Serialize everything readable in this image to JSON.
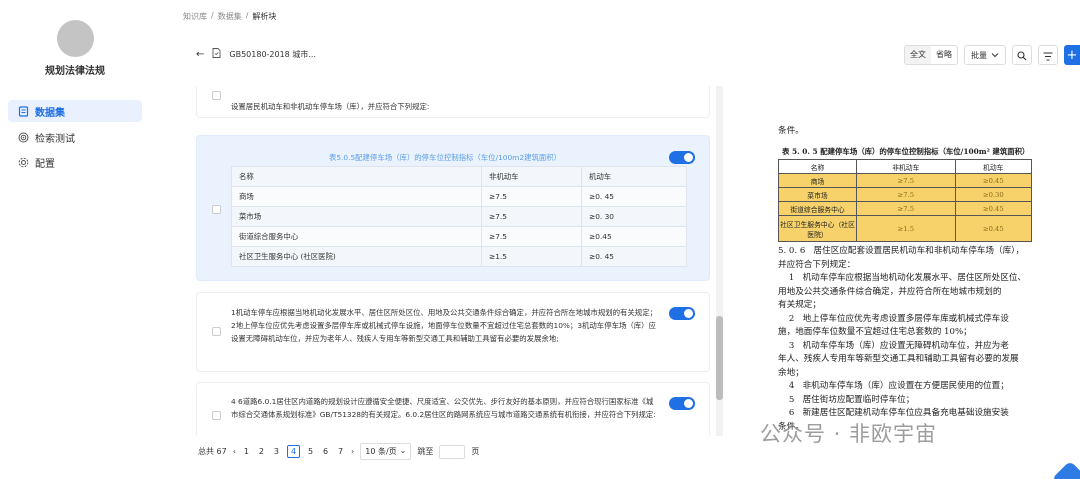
{
  "sidebar": {
    "kb_name": "规划法律法规",
    "items": [
      {
        "label": "数据集",
        "icon": "file-icon",
        "active": true
      },
      {
        "label": "检索测试",
        "icon": "target-icon",
        "active": false
      },
      {
        "label": "配置",
        "icon": "gear-icon",
        "active": false
      }
    ]
  },
  "breadcrumb": [
    "知识库",
    "数据集",
    "解析块"
  ],
  "doc": {
    "name": "GB50180-2018 城市..."
  },
  "toolbar": {
    "full_text": "全文",
    "omit": "省略",
    "batch": "批量"
  },
  "chunks": [
    {
      "text": "设置居民机动车和非机动车停车场（库），并应符合下列规定:"
    },
    {
      "table_title": "表5.0.5配建停车场（库）的停车位控制指标（车位/100m2建筑面积）",
      "headers": [
        "名称",
        "非机动车",
        "机动车"
      ],
      "rows": [
        [
          "商场",
          "≥7.5",
          "≥0. 45"
        ],
        [
          "菜市场",
          "≥7.5",
          "≥0. 30"
        ],
        [
          "街道综合服务中心",
          "≥7.5",
          "≥0.45"
        ],
        [
          "社区卫生服务中心 (社区医院)",
          "≥1.5",
          "≥0. 45"
        ]
      ]
    },
    {
      "text": "1机动车停车应根据当地机动化发展水平、居住区所处区位、用地及公共交通条件综合确定，并应符合所在地城市规划的有关规定；2地上停车位应优先考虑设置多层停车库或机械式停车设施，地面停车位数量不宜超过住宅总套数的10%；3机动车停车场（库）应设置无障碍机动车位，并应为老年人、残疾人专用车等新型交通工具和辅助工具留有必要的发展余地;"
    },
    {
      "text": "4 6道路6.0.1居住区内道路的规划设计应遵循安全便捷、尺度适宜、公交优先、步行友好的基本原则，并应符合现行国家标准《城市综合交通体系规划标准》GB/T51328的有关规定。6.0.2居住区的路网系统应与城市道路交通系统有机衔接，并应符合下列规定:"
    }
  ],
  "pager": {
    "total": "总共 67",
    "pages": [
      "1",
      "2",
      "3",
      "4",
      "5",
      "6",
      "7"
    ],
    "current": "4",
    "page_size": "10 条/页",
    "goto_label": "跳至",
    "page_unit": "页"
  },
  "preview": {
    "top_text": "条件。",
    "table_caption": "表 5. 0. 5   配建停车场（库）的停车位控制指标（车位/100m² 建筑面积）",
    "table_headers": [
      "名称",
      "非机动车",
      "机动车"
    ],
    "table_rows": [
      [
        "商场",
        "≥7.5",
        "≥0.45"
      ],
      [
        "菜市场",
        "≥7.5",
        "≥0.30"
      ],
      [
        "街道综合服务中心",
        "≥7.5",
        "≥0.45"
      ],
      [
        "社区卫生服务中心（社区医院）",
        "≥1.5",
        "≥0.45"
      ]
    ],
    "lines": [
      "5. 0. 6   居住区应配套设置居民机动车和非机动车停车场（库），",
      "并应符合下列规定：",
      "    1   机动车停车应根据当地机动化发展水平、居住区所处区位、",
      "用地及公共交通条件综合确定，并应符合所在地城市规划的",
      "有关规定；",
      "    2   地上停车位应优先考虑设置多层停车库或机械式停车设",
      "施，地面停车位数量不宜超过住宅总套数的 10%；",
      "    3   机动车停车场（库）应设置无障碍机动车位，并应为老",
      "年人、残疾人专用车等新型交通工具和辅助工具留有必要的发展",
      "余地；",
      "    4   非机动车停车场（库）应设置在方便居民使用的位置；",
      "    5   居住街坊应配置临时停车位；",
      "    6   新建居住区配建机动车停车位应具备充电基础设施安装",
      "条件。"
    ]
  },
  "watermark": "公众号 · 非欧宇宙",
  "colors": {
    "accent": "#1f6fe5",
    "table_highlight": "#f7d26b",
    "selected_card": "#eaf3fd"
  }
}
